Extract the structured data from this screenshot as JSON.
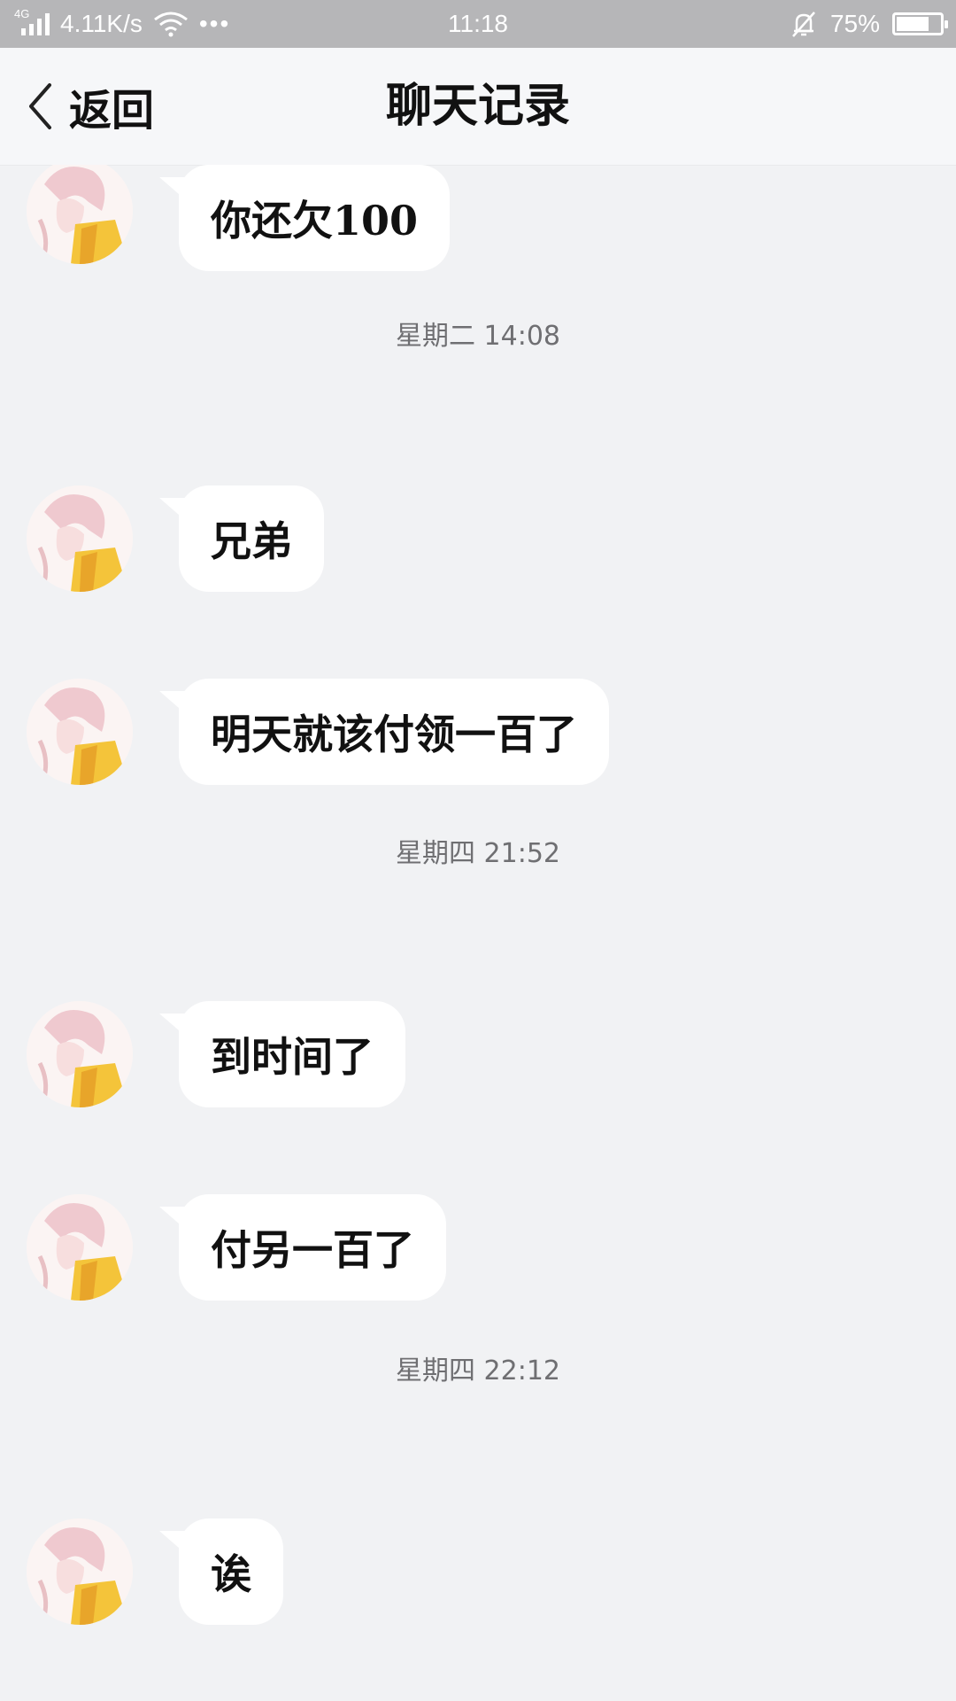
{
  "status_bar": {
    "network": "4G",
    "speed": "4.11K/s",
    "more": "•••",
    "time": "11:18",
    "battery_percent_text": "75%",
    "battery_level": 0.75
  },
  "nav": {
    "back_label": "返回",
    "title": "聊天记录"
  },
  "messages": [
    {
      "text": "你还欠100"
    },
    {
      "time": "星期二 14:08"
    },
    {
      "text": "兄弟"
    },
    {
      "text": "明天就该付领一百了"
    },
    {
      "time": "星期四 21:52"
    },
    {
      "text": "到时间了"
    },
    {
      "text": "付另一百了"
    },
    {
      "time": "星期四 22:12"
    },
    {
      "text": "诶"
    }
  ]
}
